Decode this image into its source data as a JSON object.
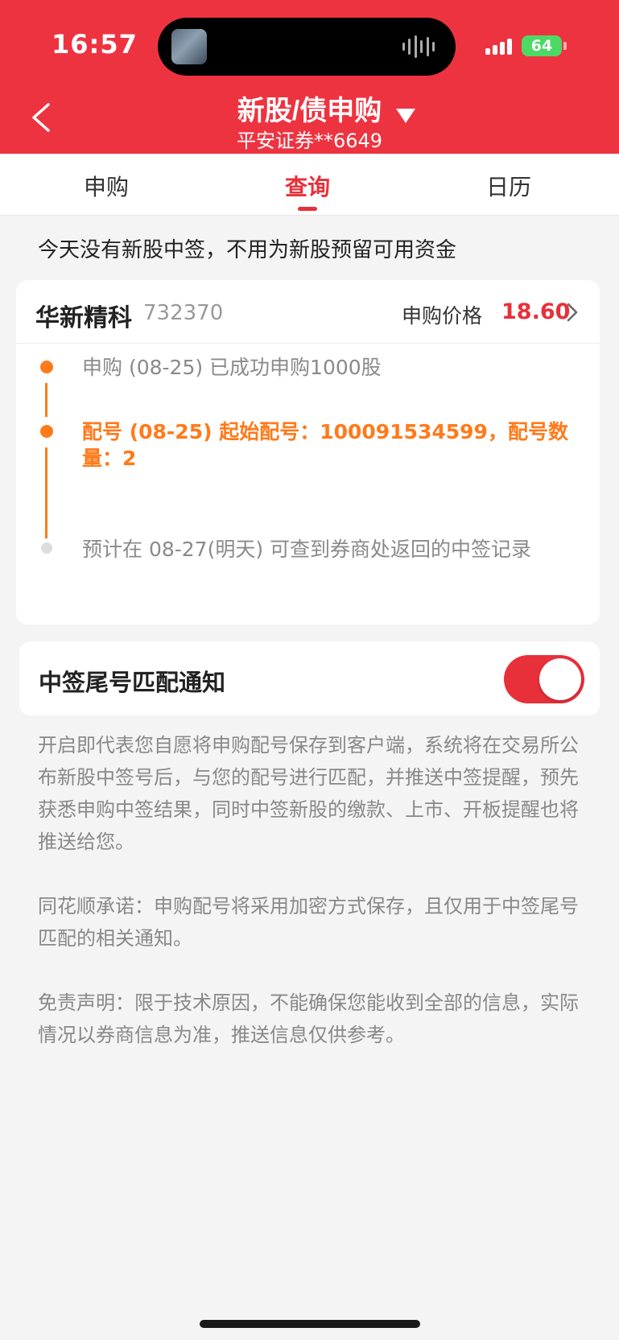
{
  "status_bar": {
    "time": "16:57",
    "battery": "64"
  },
  "nav": {
    "title": "新股/债申购",
    "subtitle": "平安证券**6649"
  },
  "tabs": [
    {
      "label": "申购"
    },
    {
      "label": "查询",
      "active": true
    },
    {
      "label": "日历"
    }
  ],
  "notice": "今天没有新股中签，不用为新股预留可用资金",
  "stock": {
    "name": "华新精科",
    "code": "732370",
    "price_label": "申购价格",
    "price": "18.60"
  },
  "timeline": [
    {
      "text": "申购 (08-25) 已成功申购1000股",
      "status": "done"
    },
    {
      "text": "配号 (08-25) 起始配号：100091534599，配号数量：2",
      "status": "current"
    },
    {
      "text": "预计在 08-27(明天) 可查到券商处返回的中签记录",
      "status": "pending"
    }
  ],
  "notify": {
    "label": "中签尾号匹配通知",
    "enabled": true
  },
  "paragraphs": [
    "开启即代表您自愿将申购配号保存到客户端，系统将在交易所公布新股中签号后，与您的配号进行匹配，并推送中签提醒，预先获悉申购中签结果，同时中签新股的缴款、上市、开板提醒也将推送给您。",
    "同花顺承诺：申购配号将采用加密方式保存，且仅用于中签尾号匹配的相关通知。",
    "免责声明：限于技术原因，不能确保您能收到全部的信息，实际情况以券商信息为准，推送信息仅供参考。"
  ],
  "colors": {
    "brand_red": "#ee3340",
    "accent_red": "#e8303a",
    "accent_orange": "#ff7a1a"
  }
}
